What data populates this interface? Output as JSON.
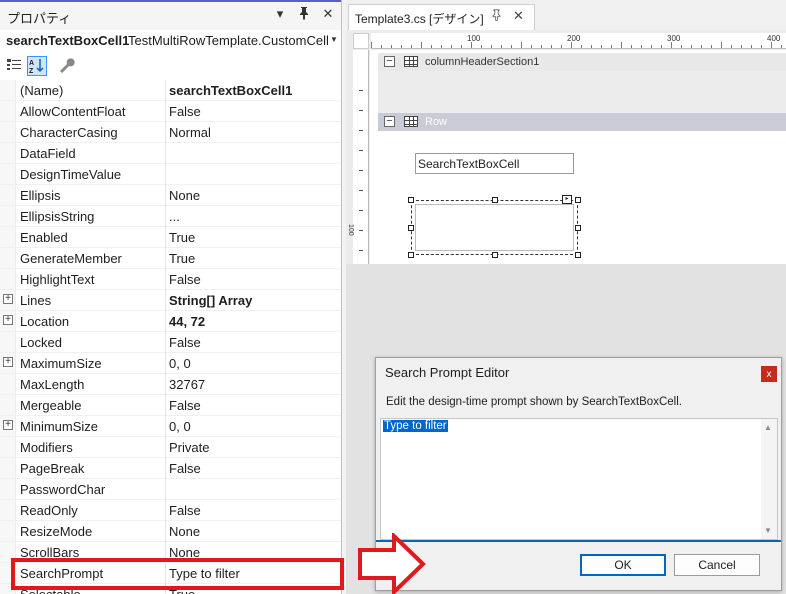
{
  "properties_panel": {
    "title": "プロパティ",
    "object_name": "searchTextBoxCell1",
    "object_type": "TestMultiRowTemplate.CustomCell",
    "toolbar": {
      "categorized_icon": "categorized-icon",
      "alphabetical_icon": "alphabetical-icon",
      "property_pages_icon": "wrench-icon"
    },
    "rows": [
      {
        "name": "(Name)",
        "value": "searchTextBoxCell1",
        "bold": true
      },
      {
        "name": "AllowContentFloat",
        "value": "False"
      },
      {
        "name": "CharacterCasing",
        "value": "Normal"
      },
      {
        "name": "DataField",
        "value": ""
      },
      {
        "name": "DesignTimeValue",
        "value": ""
      },
      {
        "name": "Ellipsis",
        "value": "None"
      },
      {
        "name": "EllipsisString",
        "value": "..."
      },
      {
        "name": "Enabled",
        "value": "True"
      },
      {
        "name": "GenerateMember",
        "value": "True"
      },
      {
        "name": "HighlightText",
        "value": "False"
      },
      {
        "name": "Lines",
        "value": "String[] Array",
        "bold": true,
        "expandable": true
      },
      {
        "name": "Location",
        "value": "44, 72",
        "bold": true,
        "expandable": true
      },
      {
        "name": "Locked",
        "value": "False"
      },
      {
        "name": "MaximumSize",
        "value": "0, 0",
        "expandable": true
      },
      {
        "name": "MaxLength",
        "value": "32767"
      },
      {
        "name": "Mergeable",
        "value": "False"
      },
      {
        "name": "MinimumSize",
        "value": "0, 0",
        "expandable": true
      },
      {
        "name": "Modifiers",
        "value": "Private"
      },
      {
        "name": "PageBreak",
        "value": "False"
      },
      {
        "name": "PasswordChar",
        "value": ""
      },
      {
        "name": "ReadOnly",
        "value": "False"
      },
      {
        "name": "ResizeMode",
        "value": "None"
      },
      {
        "name": "ScrollBars",
        "value": "None"
      },
      {
        "name": "SearchPrompt",
        "value": "Type to filter"
      },
      {
        "name": "Selectable",
        "value": "True"
      }
    ]
  },
  "designer": {
    "tab_label": "Template3.cs [デザイン]",
    "ruler_top": [
      "100",
      "200",
      "300",
      "400"
    ],
    "ruler_left": [
      "100"
    ],
    "header_section_label": "columnHeaderSection1",
    "row_section_label": "Row",
    "cell_text": "SearchTextBoxCell"
  },
  "dialog": {
    "title": "Search Prompt Editor",
    "close_label": "x",
    "description": "Edit the design-time prompt shown by SearchTextBoxCell.",
    "edit_text": "Type to filter",
    "ok_label": "OK",
    "cancel_label": "Cancel"
  },
  "colors": {
    "highlight_red": "#e0191f",
    "accent_blue": "#0067c0",
    "row_header": "#c9cbd6"
  }
}
